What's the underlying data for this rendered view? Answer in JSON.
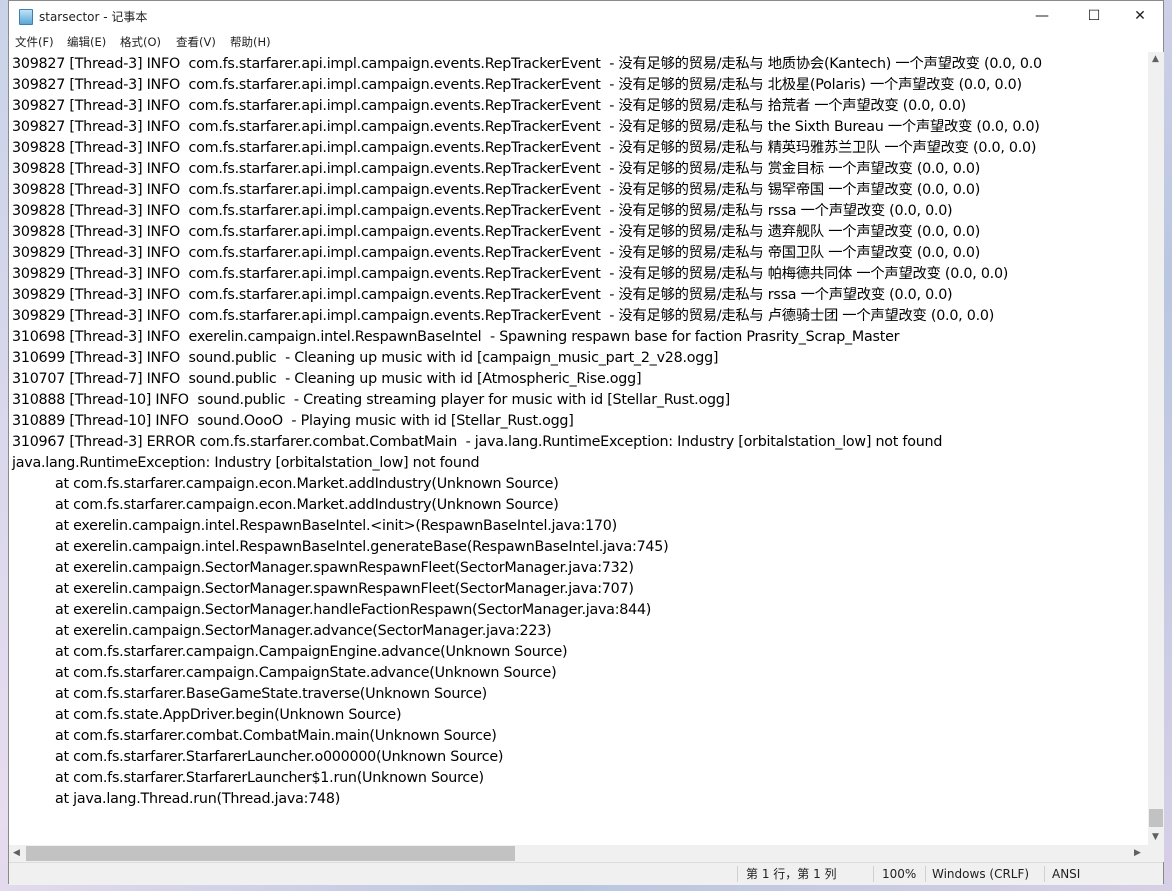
{
  "window": {
    "title": "starsector - 记事本",
    "minimize_glyph": "—",
    "maximize_glyph": "☐",
    "close_glyph": "✕"
  },
  "menu": [
    "文件(F)",
    "编辑(E)",
    "格式(O)",
    "查看(V)",
    "帮助(H)"
  ],
  "lines": [
    "309827 [Thread-3] INFO  com.fs.starfarer.api.impl.campaign.events.RepTrackerEvent  - 没有足够的贸易/走私与 地质协会(Kantech) 一个声望改变 (0.0, 0.0",
    "309827 [Thread-3] INFO  com.fs.starfarer.api.impl.campaign.events.RepTrackerEvent  - 没有足够的贸易/走私与 北极星(Polaris) 一个声望改变 (0.0, 0.0)",
    "309827 [Thread-3] INFO  com.fs.starfarer.api.impl.campaign.events.RepTrackerEvent  - 没有足够的贸易/走私与 拾荒者 一个声望改变 (0.0, 0.0)",
    "309827 [Thread-3] INFO  com.fs.starfarer.api.impl.campaign.events.RepTrackerEvent  - 没有足够的贸易/走私与 the Sixth Bureau 一个声望改变 (0.0, 0.0)",
    "309828 [Thread-3] INFO  com.fs.starfarer.api.impl.campaign.events.RepTrackerEvent  - 没有足够的贸易/走私与 精英玛雅苏兰卫队 一个声望改变 (0.0, 0.0)",
    "309828 [Thread-3] INFO  com.fs.starfarer.api.impl.campaign.events.RepTrackerEvent  - 没有足够的贸易/走私与 赏金目标 一个声望改变 (0.0, 0.0)",
    "309828 [Thread-3] INFO  com.fs.starfarer.api.impl.campaign.events.RepTrackerEvent  - 没有足够的贸易/走私与 锡罕帝国 一个声望改变 (0.0, 0.0)",
    "309828 [Thread-3] INFO  com.fs.starfarer.api.impl.campaign.events.RepTrackerEvent  - 没有足够的贸易/走私与 rssa 一个声望改变 (0.0, 0.0)",
    "309828 [Thread-3] INFO  com.fs.starfarer.api.impl.campaign.events.RepTrackerEvent  - 没有足够的贸易/走私与 遗弃舰队 一个声望改变 (0.0, 0.0)",
    "309829 [Thread-3] INFO  com.fs.starfarer.api.impl.campaign.events.RepTrackerEvent  - 没有足够的贸易/走私与 帝国卫队 一个声望改变 (0.0, 0.0)",
    "309829 [Thread-3] INFO  com.fs.starfarer.api.impl.campaign.events.RepTrackerEvent  - 没有足够的贸易/走私与 帕梅德共同体 一个声望改变 (0.0, 0.0)",
    "309829 [Thread-3] INFO  com.fs.starfarer.api.impl.campaign.events.RepTrackerEvent  - 没有足够的贸易/走私与 rssa 一个声望改变 (0.0, 0.0)",
    "309829 [Thread-3] INFO  com.fs.starfarer.api.impl.campaign.events.RepTrackerEvent  - 没有足够的贸易/走私与 卢德骑士团 一个声望改变 (0.0, 0.0)",
    "310698 [Thread-3] INFO  exerelin.campaign.intel.RespawnBaseIntel  - Spawning respawn base for faction Prasrity_Scrap_Master",
    "310699 [Thread-3] INFO  sound.public  - Cleaning up music with id [campaign_music_part_2_v28.ogg]",
    "310707 [Thread-7] INFO  sound.public  - Cleaning up music with id [Atmospheric_Rise.ogg]",
    "310888 [Thread-10] INFO  sound.public  - Creating streaming player for music with id [Stellar_Rust.ogg]",
    "310889 [Thread-10] INFO  sound.OooO  - Playing music with id [Stellar_Rust.ogg]",
    "310967 [Thread-3] ERROR com.fs.starfarer.combat.CombatMain  - java.lang.RuntimeException: Industry [orbitalstation_low] not found",
    "java.lang.RuntimeException: Industry [orbitalstation_low] not found",
    "\tat com.fs.starfarer.campaign.econ.Market.addIndustry(Unknown Source)",
    "\tat com.fs.starfarer.campaign.econ.Market.addIndustry(Unknown Source)",
    "\tat exerelin.campaign.intel.RespawnBaseIntel.<init>(RespawnBaseIntel.java:170)",
    "\tat exerelin.campaign.intel.RespawnBaseIntel.generateBase(RespawnBaseIntel.java:745)",
    "\tat exerelin.campaign.SectorManager.spawnRespawnFleet(SectorManager.java:732)",
    "\tat exerelin.campaign.SectorManager.spawnRespawnFleet(SectorManager.java:707)",
    "\tat exerelin.campaign.SectorManager.handleFactionRespawn(SectorManager.java:844)",
    "\tat exerelin.campaign.SectorManager.advance(SectorManager.java:223)",
    "\tat com.fs.starfarer.campaign.CampaignEngine.advance(Unknown Source)",
    "\tat com.fs.starfarer.campaign.CampaignState.advance(Unknown Source)",
    "\tat com.fs.starfarer.BaseGameState.traverse(Unknown Source)",
    "\tat com.fs.state.AppDriver.begin(Unknown Source)",
    "\tat com.fs.starfarer.combat.CombatMain.main(Unknown Source)",
    "\tat com.fs.starfarer.StarfarerLauncher.o000000(Unknown Source)",
    "\tat com.fs.starfarer.StarfarerLauncher$1.run(Unknown Source)",
    "\tat java.lang.Thread.run(Thread.java:748)"
  ],
  "status": {
    "position": "第 1 行，第 1 列",
    "zoom": "100%",
    "line_ending": "Windows (CRLF)",
    "encoding": "ANSI"
  }
}
